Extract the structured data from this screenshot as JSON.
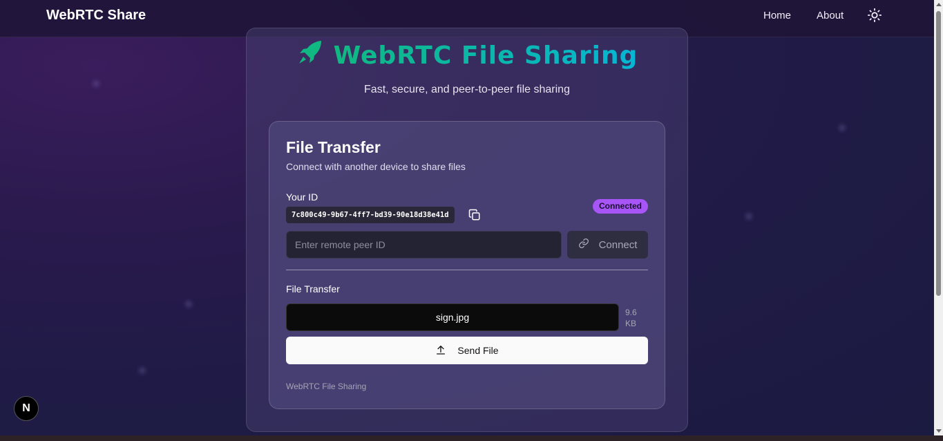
{
  "navbar": {
    "brand": "WebRTC Share",
    "links": [
      {
        "label": "Home"
      },
      {
        "label": "About"
      }
    ],
    "theme_icon": "sun-icon"
  },
  "hero": {
    "icon": "rocket-icon",
    "title": "WebRTC File Sharing",
    "subtitle": "Fast, secure, and peer-to-peer file sharing"
  },
  "card": {
    "title": "File Transfer",
    "description": "Connect with another device to share files",
    "id_label": "Your ID",
    "id_value": "7c800c49-9b67-4ff7-bd39-90e18d38e41d",
    "copy_icon": "copy-icon",
    "status": "Connected",
    "peer_input": {
      "value": "",
      "placeholder": "Enter remote peer ID"
    },
    "connect_label": "Connect",
    "connect_icon": "link-icon",
    "transfer_label": "File Transfer",
    "file": {
      "name": "sign.jpg",
      "size": "9.6 KB"
    },
    "send_label": "Send File",
    "send_icon": "upload-icon",
    "footer": "WebRTC File Sharing"
  },
  "next_badge": "N",
  "colors": {
    "accent_green": "#10b981",
    "accent_cyan": "#06b6d4",
    "badge_purple": "#a855f7"
  }
}
